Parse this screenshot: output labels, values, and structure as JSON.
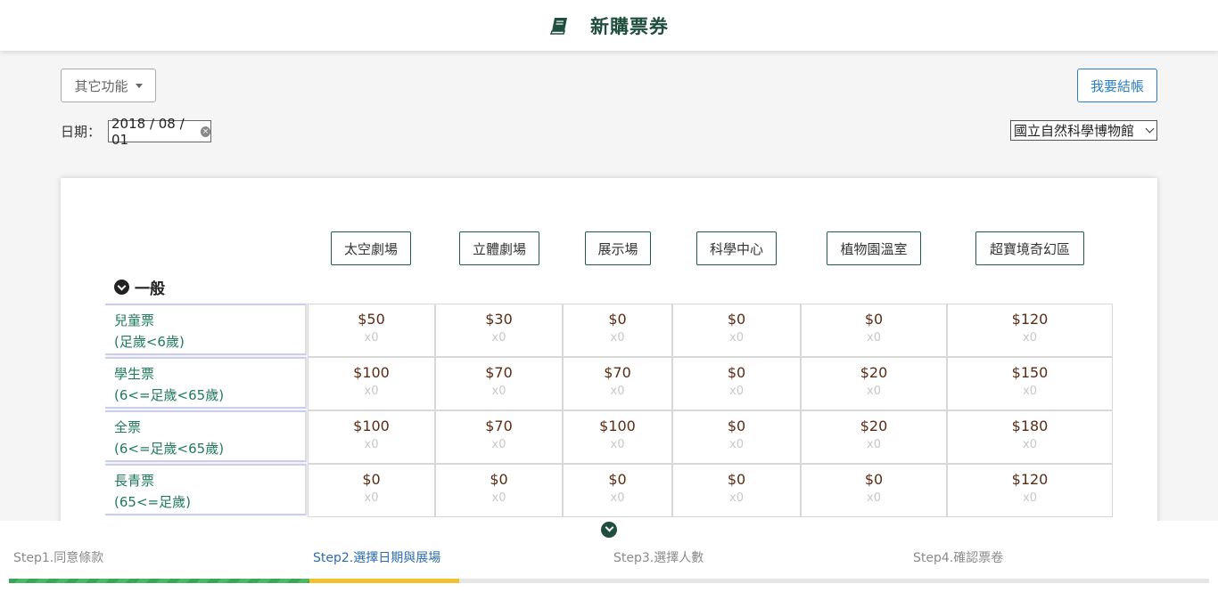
{
  "header": {
    "title": "新購票券",
    "icon": "book-icon"
  },
  "toolbar": {
    "more_functions": "其它功能",
    "checkout": "我要結帳"
  },
  "date": {
    "label": "日期：",
    "value": "2018 / 08 / 01"
  },
  "venue_select": {
    "value": "國立自然科學博物館"
  },
  "venues": [
    "太空劇場",
    "立體劇場",
    "展示場",
    "科學中心",
    "植物園溫室",
    "超寶境奇幻區"
  ],
  "section": {
    "title": "一般"
  },
  "ticket_rows": [
    {
      "name": "兒童票",
      "desc": "(足歲<6歲)",
      "prices": [
        "$50",
        "$30",
        "$0",
        "$0",
        "$0",
        "$120"
      ],
      "qty": [
        "x0",
        "x0",
        "x0",
        "x0",
        "x0",
        "x0"
      ]
    },
    {
      "name": "學生票",
      "desc": "(6<=足歲<65歲)",
      "prices": [
        "$100",
        "$70",
        "$70",
        "$0",
        "$20",
        "$150"
      ],
      "qty": [
        "x0",
        "x0",
        "x0",
        "x0",
        "x0",
        "x0"
      ]
    },
    {
      "name": "全票",
      "desc": "(6<=足歲<65歲)",
      "prices": [
        "$100",
        "$70",
        "$100",
        "$0",
        "$20",
        "$180"
      ],
      "qty": [
        "x0",
        "x0",
        "x0",
        "x0",
        "x0",
        "x0"
      ]
    },
    {
      "name": "長青票",
      "desc": "(65<=足歲)",
      "prices": [
        "$0",
        "$0",
        "$0",
        "$0",
        "$0",
        "$120"
      ],
      "qty": [
        "x0",
        "x0",
        "x0",
        "x0",
        "x0",
        "x0"
      ]
    }
  ],
  "steps": [
    {
      "label": "Step1.同意條款",
      "state": "done"
    },
    {
      "label": "Step2.選擇日期與展場",
      "state": "active"
    },
    {
      "label": "Step3.選擇人數",
      "state": "todo"
    },
    {
      "label": "Step4.確認票卷",
      "state": "todo"
    }
  ],
  "colors": {
    "brand": "#1f4e3d",
    "link": "#2b7fc4",
    "done": "#3aa655",
    "current": "#f2c12e"
  }
}
